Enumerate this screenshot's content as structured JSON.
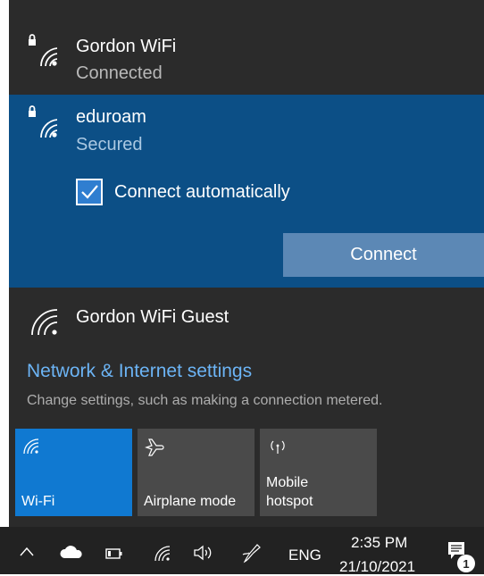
{
  "networks": [
    {
      "name": "Gordon WiFi",
      "status": "Connected",
      "secured": true
    },
    {
      "name": "eduroam",
      "status": "Secured",
      "secured": true,
      "selected": true
    },
    {
      "name": "Gordon WiFi Guest",
      "status": "",
      "secured": false
    }
  ],
  "connect_panel": {
    "checkbox_label": "Connect automatically",
    "checkbox_checked": true,
    "button_label": "Connect"
  },
  "settings": {
    "link": "Network & Internet settings",
    "description": "Change settings, such as making a connection metered."
  },
  "quick_actions": [
    {
      "label": "Wi-Fi",
      "icon": "wifi-icon",
      "active": true
    },
    {
      "label": "Airplane mode",
      "icon": "airplane-icon",
      "active": false
    },
    {
      "label": "Mobile hotspot",
      "line1": "Mobile",
      "line2": "hotspot",
      "icon": "hotspot-icon",
      "active": false
    }
  ],
  "taskbar": {
    "icons": [
      "chevron-up-icon",
      "cloud-icon",
      "battery-icon",
      "wifi-icon",
      "volume-icon",
      "pen-icon"
    ],
    "language": "ENG",
    "time": "2:35 PM",
    "date": "21/10/2021",
    "notification_count": "1"
  },
  "colors": {
    "flyout_bg": "#2b2b2b",
    "selected_bg": "#0c4f86",
    "accent": "#1079d1",
    "link": "#6cb4f5",
    "taskbar_bg": "#222222"
  }
}
